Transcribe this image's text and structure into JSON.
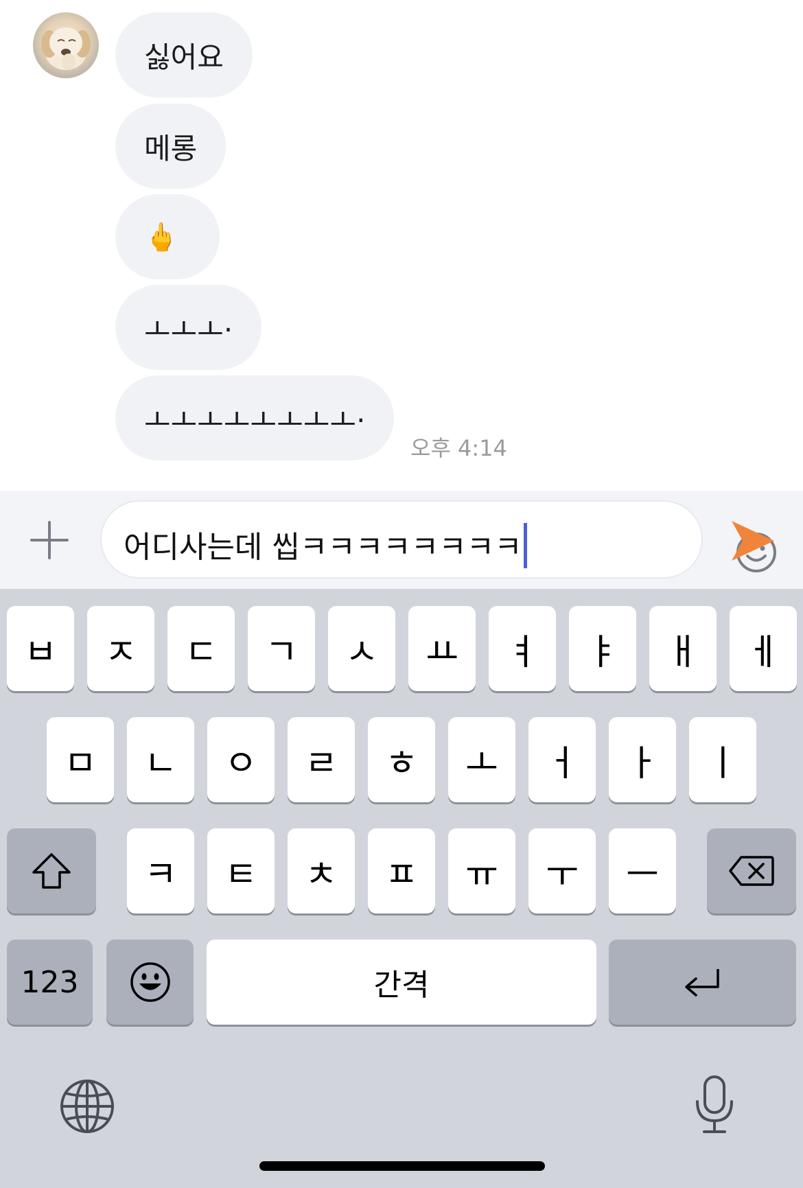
{
  "messages": [
    {
      "text": "싫어요"
    },
    {
      "text": "메롱"
    },
    {
      "text": "🖕"
    },
    {
      "text": "ㅗㅗㅗ·"
    },
    {
      "text": "ㅗㅗㅗㅗㅗㅗㅗㅗ·"
    }
  ],
  "timestamp": "오후 4:14",
  "composer": {
    "value": "어디사는데 씹ㅋㅋㅋㅋㅋㅋㅋㅋ",
    "send_color": "#f0843c"
  },
  "keyboard": {
    "row1": [
      "ㅂ",
      "ㅈ",
      "ㄷ",
      "ㄱ",
      "ㅅ",
      "ㅛ",
      "ㅕ",
      "ㅑ",
      "ㅐ",
      "ㅔ"
    ],
    "row2": [
      "ㅁ",
      "ㄴ",
      "ㅇ",
      "ㄹ",
      "ㅎ",
      "ㅗ",
      "ㅓ",
      "ㅏ",
      "ㅣ"
    ],
    "row3": [
      "ㅋ",
      "ㅌ",
      "ㅊ",
      "ㅍ",
      "ㅠ",
      "ㅜ",
      "ㅡ"
    ],
    "numbers_label": "123",
    "space_label": "간격"
  }
}
